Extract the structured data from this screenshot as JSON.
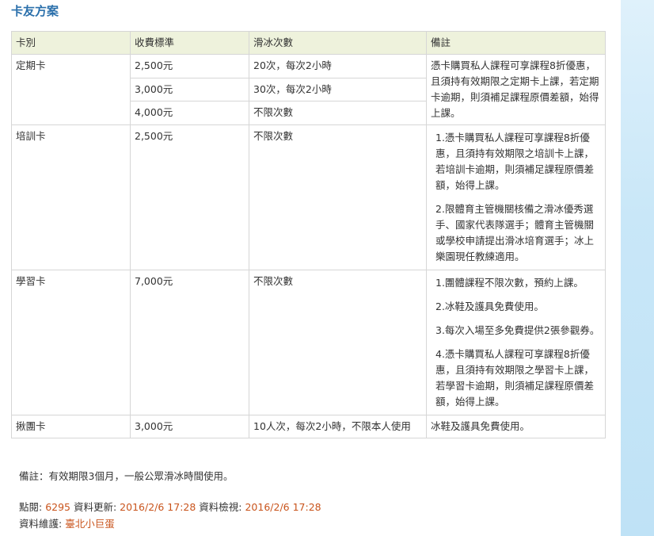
{
  "page": {
    "title": "卡友方案"
  },
  "table": {
    "headers": [
      "卡別",
      "收費標準",
      "滑冰次數",
      "備註"
    ],
    "rows": [
      {
        "type": "定期卡",
        "options": [
          {
            "price": "2,500元",
            "count": "20次，每次2小時"
          },
          {
            "price": "3,000元",
            "count": "30次，每次2小時"
          },
          {
            "price": "4,000元",
            "count": "不限次數"
          }
        ],
        "note": "憑卡購買私人課程可享課程8折優惠，且須持有效期限之定期卡上課，若定期卡逾期，則須補足課程原價差額，始得上課。"
      },
      {
        "type": "培訓卡",
        "price": "2,500元",
        "count": "不限次數",
        "notes": [
          "1.憑卡購買私人課程可享課程8折優惠，且須持有效期限之培訓卡上課，若培訓卡逾期，則須補足課程原價差額，始得上課。",
          "2.限體育主管機關核備之滑冰優秀選手、國家代表隊選手；體育主管機關或學校申請提出滑冰培育選手；冰上樂園現任教練適用。"
        ]
      },
      {
        "type": "學習卡",
        "price": "7,000元",
        "count": "不限次數",
        "notes": [
          "1.團體課程不限次數，預約上課。",
          "2.冰鞋及護具免費使用。",
          "3.每次入場至多免費提供2張參觀券。",
          "4.憑卡購買私人課程可享課程8折優惠，且須持有效期限之學習卡上課，若學習卡逾期，則須補足課程原價差額，始得上課。"
        ]
      },
      {
        "type": "揪團卡",
        "price": "3,000元",
        "count": "10人次，每次2小時，不限本人使用",
        "note": "冰鞋及護具免費使用。"
      }
    ]
  },
  "footer": {
    "note": "備註：有效期限3個月，一般公眾滑冰時間使用。",
    "views_label": "點閱: ",
    "views": "6295",
    "updated_label": " 資料更新: ",
    "updated": "2016/2/6 17:28",
    "reviewed_label": " 資料檢視: ",
    "reviewed": "2016/2/6 17:28",
    "maintainer_label": "資料維護: ",
    "maintainer": "臺北小巨蛋"
  }
}
